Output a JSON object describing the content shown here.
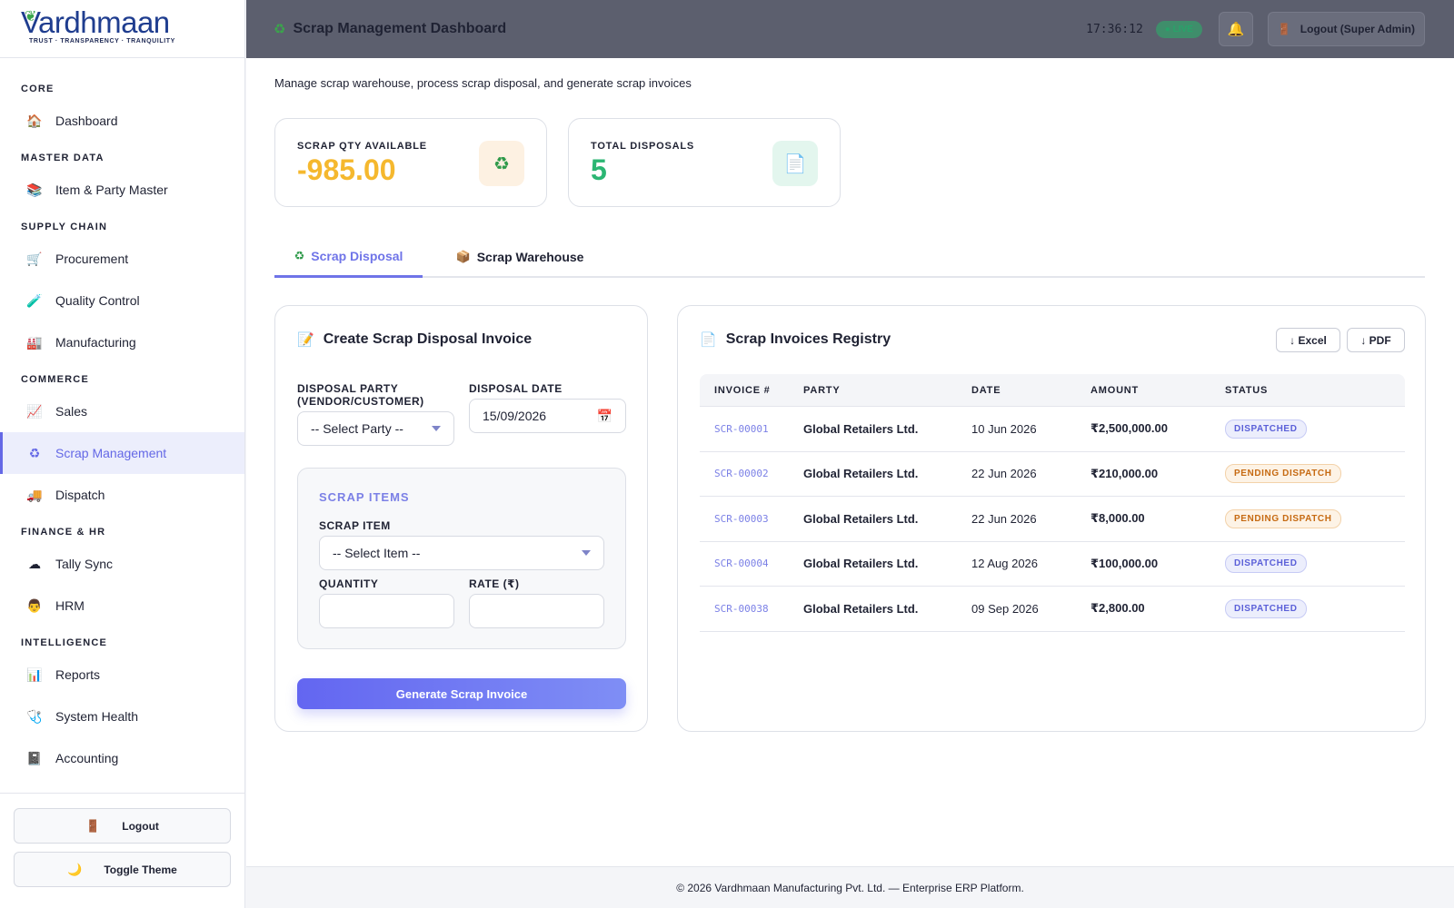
{
  "brand": {
    "name": "Vardhmaan",
    "tagline": "TRUST · TRANSPARENCY · TRANQUILITY"
  },
  "sidebar": {
    "sections": [
      {
        "title": "CORE",
        "items": [
          {
            "label": "Dashboard",
            "icon": "🏠"
          }
        ]
      },
      {
        "title": "MASTER DATA",
        "items": [
          {
            "label": "Item & Party Master",
            "icon": "📚"
          }
        ]
      },
      {
        "title": "SUPPLY CHAIN",
        "items": [
          {
            "label": "Procurement",
            "icon": "🛒"
          },
          {
            "label": "Quality Control",
            "icon": "🧪"
          },
          {
            "label": "Manufacturing",
            "icon": "🏭"
          }
        ]
      },
      {
        "title": "COMMERCE",
        "items": [
          {
            "label": "Sales",
            "icon": "📈"
          },
          {
            "label": "Scrap Management",
            "icon": "♻",
            "active": true
          },
          {
            "label": "Dispatch",
            "icon": "🚚"
          }
        ]
      },
      {
        "title": "FINANCE & HR",
        "items": [
          {
            "label": "Tally Sync",
            "icon": "☁"
          },
          {
            "label": "HRM",
            "icon": "👨"
          }
        ]
      },
      {
        "title": "INTELLIGENCE",
        "items": [
          {
            "label": "Reports",
            "icon": "📊"
          },
          {
            "label": "System Health",
            "icon": "🩺"
          },
          {
            "label": "Accounting",
            "icon": "📓"
          }
        ]
      }
    ],
    "logout_label": "Logout",
    "toggle_theme_label": "Toggle Theme"
  },
  "header": {
    "title": "Scrap Management Dashboard",
    "clock": "17:36:12",
    "live_label": "LIVE",
    "logout_label": "Logout (Super Admin)"
  },
  "page": {
    "subtitle": "Manage scrap warehouse, process scrap disposal, and generate scrap invoices"
  },
  "stats": {
    "scrap_qty": {
      "label": "SCRAP QTY AVAILABLE",
      "value": "-985.00",
      "color": "#f5b82e"
    },
    "total_disposals": {
      "label": "TOTAL DISPOSALS",
      "value": "5",
      "color": "#2bb673"
    }
  },
  "tabs": [
    {
      "label": "Scrap Disposal",
      "icon": "♻",
      "active": true
    },
    {
      "label": "Scrap Warehouse",
      "icon": "📦",
      "active": false
    }
  ],
  "disposal_form": {
    "title": "Create Scrap Disposal Invoice",
    "party_label_line1": "DISPOSAL PARTY",
    "party_label_line2": "(VENDOR/CUSTOMER)",
    "party_value": "-- Select Party --",
    "date_label": "DISPOSAL DATE",
    "date_value": "15/09/2026",
    "items_section": "SCRAP ITEMS",
    "item_label": "SCRAP ITEM",
    "item_value": "-- Select Item --",
    "qty_label": "QUANTITY",
    "rate_label": "RATE (₹)",
    "qty_value": "",
    "rate_value": "",
    "submit_label": "Generate Scrap Invoice"
  },
  "registry": {
    "title": "Scrap Invoices Registry",
    "excel_label": "↓ Excel",
    "pdf_label": "↓ PDF",
    "columns": [
      "INVOICE #",
      "PARTY",
      "DATE",
      "AMOUNT",
      "STATUS"
    ],
    "rows": [
      {
        "invoice": "SCR-00001",
        "party": "Global Retailers Ltd.",
        "date": "10 Jun 2026",
        "amount": "₹2,500,000.00",
        "status": "DISPATCHED",
        "status_kind": "dispatched"
      },
      {
        "invoice": "SCR-00002",
        "party": "Global Retailers Ltd.",
        "date": "22 Jun 2026",
        "amount": "₹210,000.00",
        "status": "PENDING DISPATCH",
        "status_kind": "pending"
      },
      {
        "invoice": "SCR-00003",
        "party": "Global Retailers Ltd.",
        "date": "22 Jun 2026",
        "amount": "₹8,000.00",
        "status": "PENDING DISPATCH",
        "status_kind": "pending"
      },
      {
        "invoice": "SCR-00004",
        "party": "Global Retailers Ltd.",
        "date": "12 Aug 2026",
        "amount": "₹100,000.00",
        "status": "DISPATCHED",
        "status_kind": "dispatched"
      },
      {
        "invoice": "SCR-00038",
        "party": "Global Retailers Ltd.",
        "date": "09 Sep 2026",
        "amount": "₹2,800.00",
        "status": "DISPATCHED",
        "status_kind": "dispatched"
      }
    ]
  },
  "footer": {
    "text": "© 2026 Vardhmaan Manufacturing Pvt. Ltd. — Enterprise ERP Platform."
  }
}
